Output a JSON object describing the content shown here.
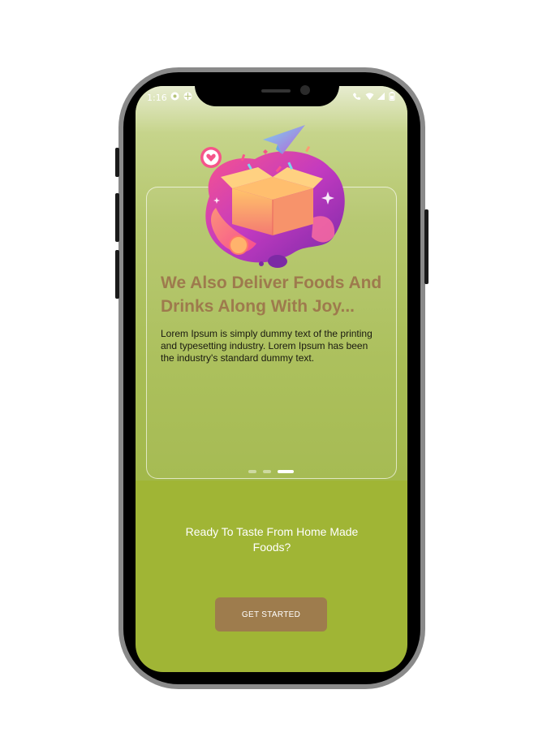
{
  "status_bar": {
    "time": "1:16",
    "left_icons": [
      "app-notification-icon",
      "settings-notification-icon"
    ],
    "right_icons": [
      "wifi-calling-icon",
      "wifi-icon",
      "signal-icon",
      "battery-icon"
    ]
  },
  "onboarding": {
    "headline": "We Also Deliver Foods And Drinks Along With Joy...",
    "body": "Lorem Ipsum is simply dummy text of the printing and typesetting industry. Lorem Ipsum has been the industry's standard dummy text.",
    "illustration": "delivery-box-illustration",
    "pagination": {
      "total": 3,
      "active": 3
    }
  },
  "tagline": "Ready To Taste From Home Made Foods?",
  "cta": {
    "label": "GET STARTED"
  },
  "colors": {
    "accent": "#9e7c4d",
    "background_green": "#a0b535",
    "headline": "#9e7a4d"
  }
}
